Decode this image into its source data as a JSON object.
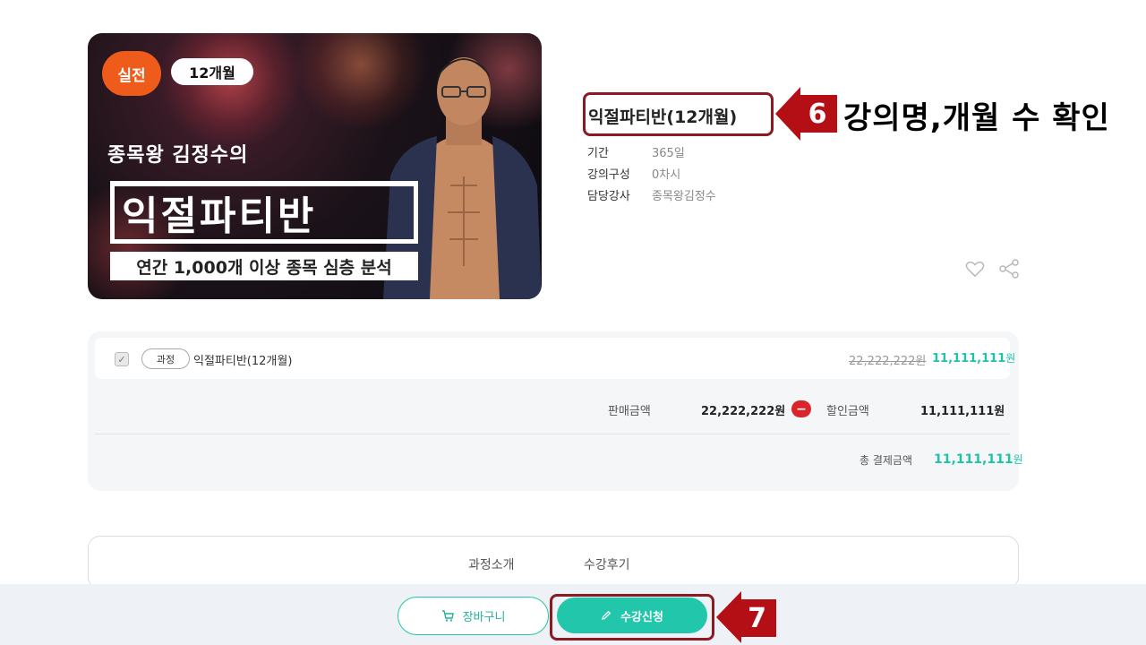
{
  "banner": {
    "tag_level": "실전",
    "tag_period": "12개월",
    "subtitle": "종목왕 김정수의",
    "title": "익절파티반",
    "caption": "연간 1,000개 이상 종목 심층 분석"
  },
  "course": {
    "title": "익절파티반(12개월)",
    "meta": [
      {
        "key": "기간",
        "value": "365일"
      },
      {
        "key": "강의구성",
        "value": "0차시"
      },
      {
        "key": "담당강사",
        "value": "종목왕김정수"
      }
    ]
  },
  "annotations": {
    "step6_number": "6",
    "step6_text": "강의명,개월 수 확인",
    "step7_number": "7"
  },
  "price": {
    "item_type": "과정",
    "item_name": "익절파티반(12개월)",
    "original": "22,222,222원",
    "sale_number": "11,111,111",
    "sale_unit": "원",
    "sale_label": "판매금액",
    "sale_amount": "22,222,222원",
    "minus_sign": "−",
    "discount_label": "할인금액",
    "discount_amount": "11,111,111원",
    "total_label": "총 결제금액",
    "total_number": "11,111,111",
    "total_unit": "원"
  },
  "tabs": [
    "과정소개",
    "수강후기"
  ],
  "actions": {
    "cart_label": "장바구니",
    "apply_label": "수강신청"
  },
  "colors": {
    "accent": "#22c7ab",
    "annotation_red": "#b50f16",
    "tag_orange": "#ee5b1a"
  }
}
